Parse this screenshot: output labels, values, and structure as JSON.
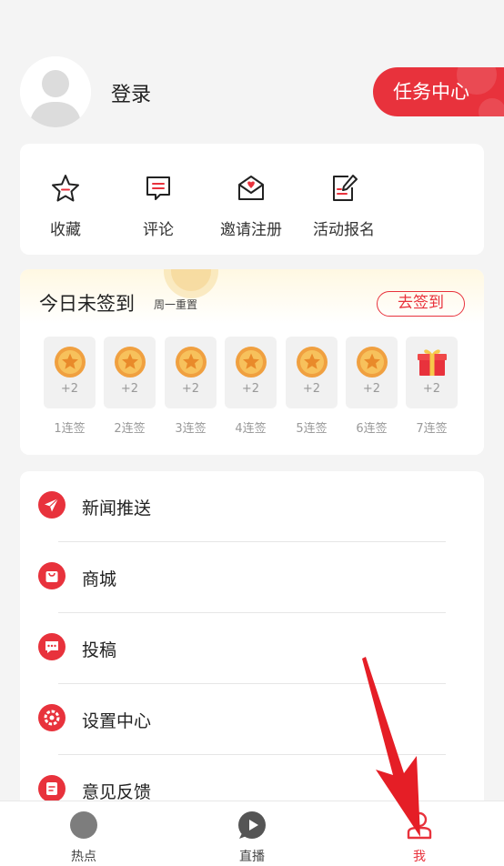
{
  "header": {
    "login_label": "登录",
    "task_center_label": "任务中心"
  },
  "quick_actions": [
    {
      "label": "收藏",
      "icon": "star-icon"
    },
    {
      "label": "评论",
      "icon": "comment-icon"
    },
    {
      "label": "邀请注册",
      "icon": "invite-envelope-icon"
    },
    {
      "label": "活动报名",
      "icon": "signup-form-icon"
    }
  ],
  "sign_in": {
    "title": "今日未签到",
    "subtitle": "周一重置",
    "button_label": "去签到",
    "days": [
      {
        "points": "+2",
        "label": "1连签",
        "icon": "coin-icon"
      },
      {
        "points": "+2",
        "label": "2连签",
        "icon": "coin-icon"
      },
      {
        "points": "+2",
        "label": "3连签",
        "icon": "coin-icon"
      },
      {
        "points": "+2",
        "label": "4连签",
        "icon": "coin-icon"
      },
      {
        "points": "+2",
        "label": "5连签",
        "icon": "coin-icon"
      },
      {
        "points": "+2",
        "label": "6连签",
        "icon": "coin-icon"
      },
      {
        "points": "+2",
        "label": "7连签",
        "icon": "gift-icon"
      }
    ]
  },
  "menu": [
    {
      "label": "新闻推送",
      "icon": "paper-plane-icon"
    },
    {
      "label": "商城",
      "icon": "shopping-bag-icon"
    },
    {
      "label": "投稿",
      "icon": "message-dots-icon"
    },
    {
      "label": "设置中心",
      "icon": "gear-icon"
    },
    {
      "label": "意见反馈",
      "icon": "feedback-icon"
    }
  ],
  "tabbar": [
    {
      "label": "热点",
      "icon": "hot-icon",
      "active": false
    },
    {
      "label": "直播",
      "icon": "play-icon",
      "active": false
    },
    {
      "label": "我",
      "icon": "user-icon",
      "active": true
    }
  ],
  "colors": {
    "accent": "#e8323c",
    "background": "#f4f4f4",
    "coin": "#f0a040"
  }
}
